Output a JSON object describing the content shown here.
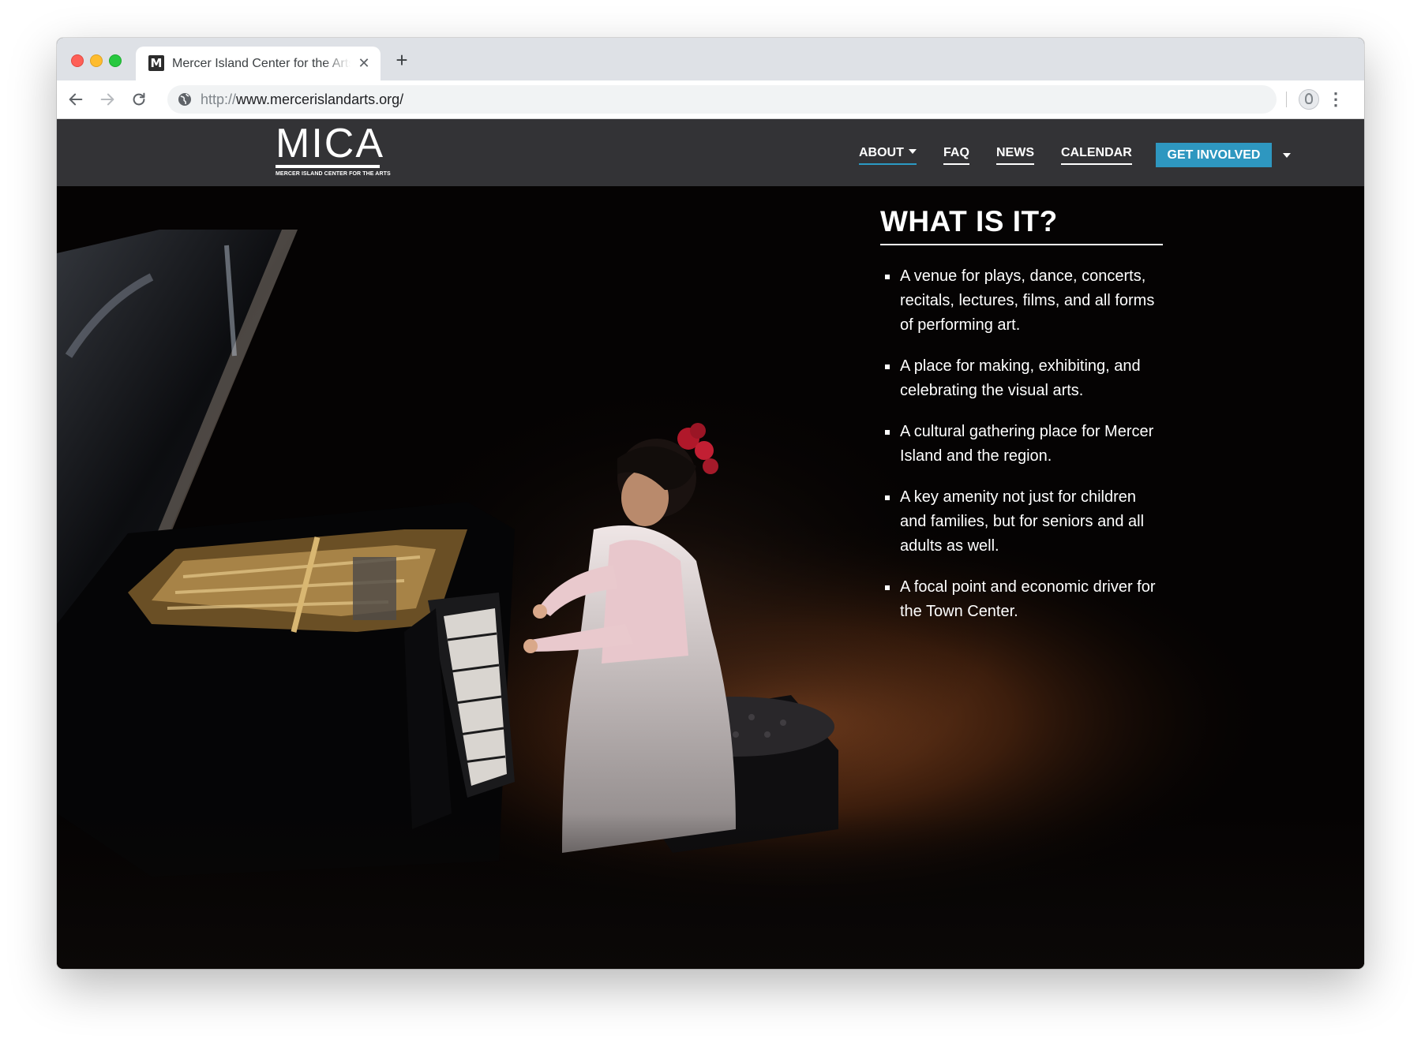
{
  "browser": {
    "tab_title": "Mercer Island Center for the Arts",
    "tab_favicon_letter": "M",
    "address_scheme": "http://",
    "address_rest": "www.mercerislandarts.org/"
  },
  "site": {
    "logo_text": "MICA",
    "logo_subtitle": "MERCER ISLAND CENTER FOR THE ARTS",
    "nav": {
      "about": "ABOUT",
      "faq": "FAQ",
      "news": "NEWS",
      "calendar": "CALENDAR",
      "cta": "GET INVOLVED"
    },
    "colors": {
      "accent": "#2e97c0",
      "navbar": "#37373a"
    }
  },
  "panel": {
    "title": "WHAT IS IT?",
    "items": [
      "A venue for plays, dance, concerts, recitals, lectures, films, and all forms of performing art.",
      "A place for making, exhibiting, and celebrating the visual arts.",
      "A cultural gathering place for Mercer Island and the region.",
      "A key amenity not just for children and families, but for seniors and all adults as well.",
      "A focal point and economic driver for the Town Center."
    ]
  }
}
